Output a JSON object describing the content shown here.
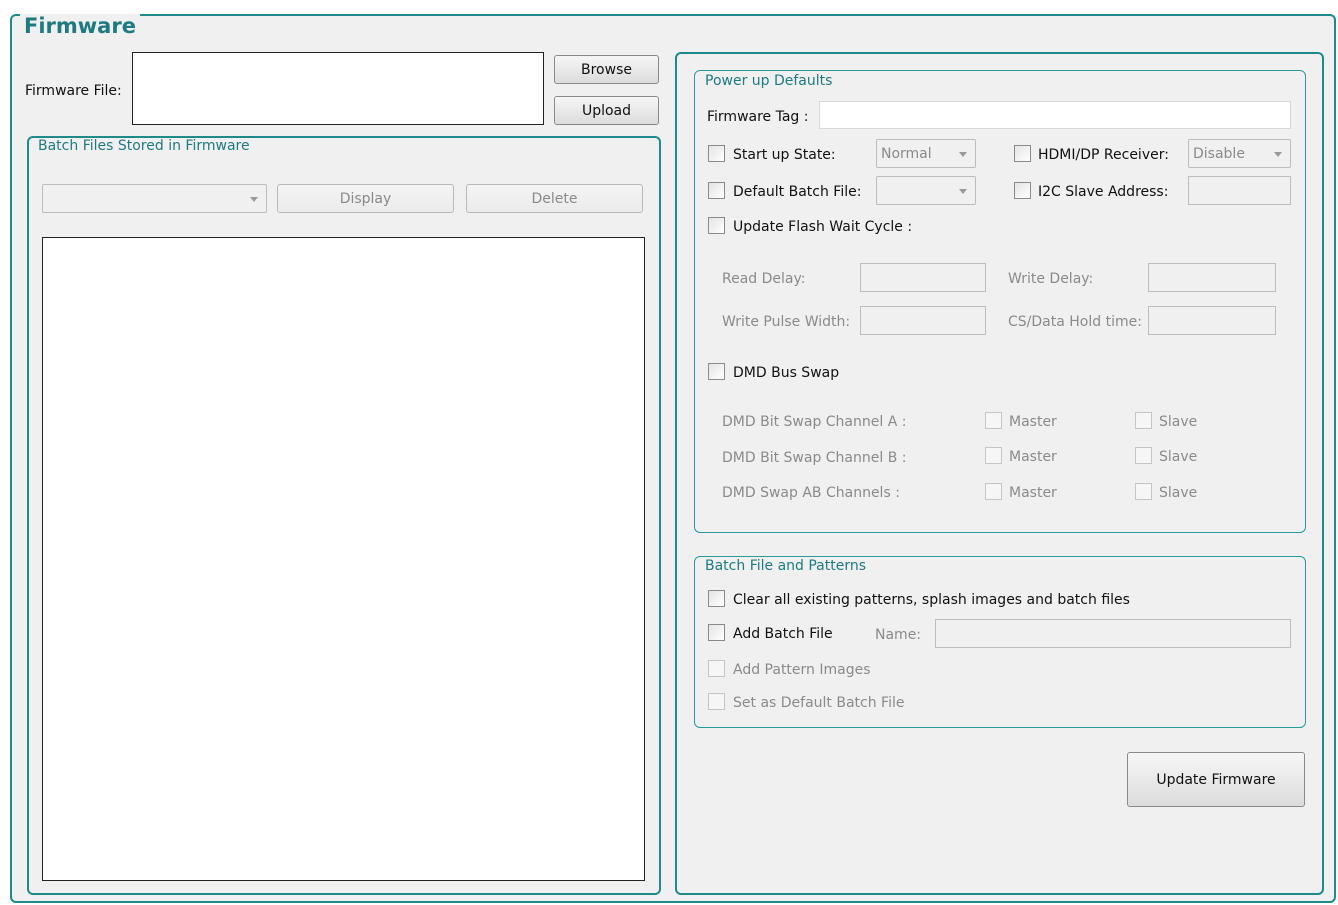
{
  "firmware": {
    "title": "Firmware",
    "file_label": "Firmware File:",
    "file_value": "",
    "browse_label": "Browse",
    "upload_label": "Upload"
  },
  "batch_stored": {
    "title": "Batch Files Stored in Firmware",
    "combo_value": "",
    "display_label": "Display",
    "delete_label": "Delete"
  },
  "power_up": {
    "title": "Power up Defaults",
    "firmware_tag_label": "Firmware Tag :",
    "firmware_tag_value": "",
    "startup_state_label": "Start up State:",
    "startup_state_value": "Normal",
    "hdmi_label": "HDMI/DP Receiver:",
    "hdmi_value": "Disable",
    "default_batch_label": "Default Batch File:",
    "default_batch_value": "",
    "i2c_label": "I2C Slave Address:",
    "i2c_value": "",
    "flash_wait_label": "Update Flash Wait Cycle :",
    "read_delay_label": "Read Delay:",
    "write_delay_label": "Write Delay:",
    "write_pulse_label": "Write Pulse Width:",
    "cs_hold_label": "CS/Data Hold time:",
    "dmd_bus_swap_label": "DMD Bus Swap",
    "swap_rows": [
      {
        "label": "DMD Bit Swap Channel A :",
        "master": "Master",
        "slave": "Slave"
      },
      {
        "label": "DMD Bit Swap Channel B :",
        "master": "Master",
        "slave": "Slave"
      },
      {
        "label": "DMD Swap AB Channels :",
        "master": "Master",
        "slave": "Slave"
      }
    ]
  },
  "batch_patterns": {
    "title": "Batch File and Patterns",
    "clear_label": "Clear all existing patterns, splash images and batch files",
    "add_batch_label": "Add Batch File",
    "name_label": "Name:",
    "name_value": "",
    "add_pattern_label": "Add Pattern Images",
    "set_default_label": "Set as Default Batch File"
  },
  "update_firmware_label": "Update Firmware",
  "colors": {
    "accent": "#1e8a8a",
    "group_text": "#1e7a80",
    "background": "#f0f0f0",
    "disabled_text": "#8a8a8a"
  }
}
